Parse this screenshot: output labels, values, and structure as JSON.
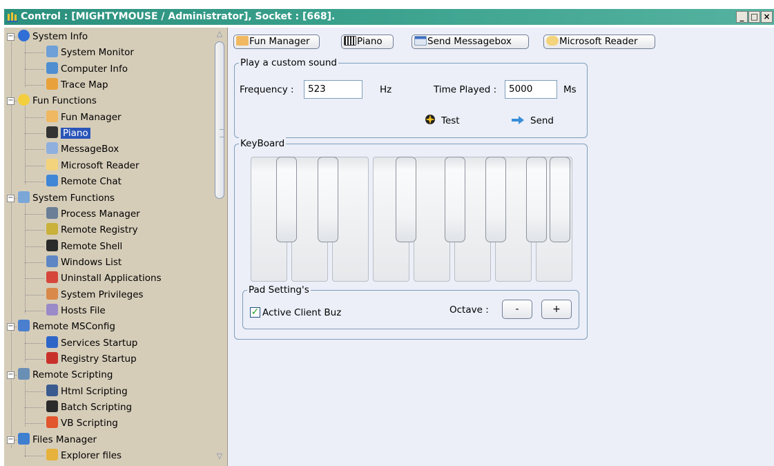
{
  "window": {
    "title": "Control : [MIGHTYMOUSE / Administrator], Socket : [668].",
    "minimize": "_",
    "maximize": "□",
    "close": "×"
  },
  "tree": [
    {
      "label": "System Info",
      "icon": "info-icon",
      "level": 0,
      "expander": "−"
    },
    {
      "label": "System Monitor",
      "icon": "system-monitor-icon",
      "level": 1
    },
    {
      "label": "Computer Info",
      "icon": "computer-icon",
      "level": 1
    },
    {
      "label": "Trace Map",
      "icon": "trace-map-icon",
      "level": 1
    },
    {
      "label": "Fun Functions",
      "icon": "smiley-icon",
      "level": 0,
      "expander": "−"
    },
    {
      "label": "Fun Manager",
      "icon": "fun-manager-icon",
      "level": 1
    },
    {
      "label": "Piano",
      "icon": "piano-icon",
      "level": 1,
      "selected": true
    },
    {
      "label": "MessageBox",
      "icon": "messagebox-icon",
      "level": 1
    },
    {
      "label": "Microsoft Reader",
      "icon": "reader-icon",
      "level": 1
    },
    {
      "label": "Remote Chat",
      "icon": "chat-icon",
      "level": 1
    },
    {
      "label": "System Functions",
      "icon": "system-functions-icon",
      "level": 0,
      "expander": "−"
    },
    {
      "label": "Process Manager",
      "icon": "process-icon",
      "level": 1
    },
    {
      "label": "Remote Registry",
      "icon": "registry-icon",
      "level": 1
    },
    {
      "label": "Remote Shell",
      "icon": "shell-icon",
      "level": 1
    },
    {
      "label": "Windows List",
      "icon": "window-icon",
      "level": 1
    },
    {
      "label": "Uninstall Applications",
      "icon": "uninstall-icon",
      "level": 1
    },
    {
      "label": "System Privileges",
      "icon": "shield-icon",
      "level": 1
    },
    {
      "label": "Hosts File",
      "icon": "hosts-file-icon",
      "level": 1
    },
    {
      "label": "Remote MSConfig",
      "icon": "msconfig-icon",
      "level": 0,
      "expander": "−"
    },
    {
      "label": "Services Startup",
      "icon": "services-icon",
      "level": 1
    },
    {
      "label": "Registry Startup",
      "icon": "toolbox-icon",
      "level": 1
    },
    {
      "label": "Remote Scripting",
      "icon": "script-icon",
      "level": 0,
      "expander": "−"
    },
    {
      "label": "Html Scripting",
      "icon": "html-icon",
      "level": 1
    },
    {
      "label": "Batch Scripting",
      "icon": "batch-icon",
      "level": 1
    },
    {
      "label": "VB Scripting",
      "icon": "vb-icon",
      "level": 1
    },
    {
      "label": "Files Manager",
      "icon": "files-icon",
      "level": 0,
      "expander": "−"
    },
    {
      "label": "Explorer files",
      "icon": "explorer-icon",
      "level": 1
    }
  ],
  "toolbar": {
    "fun_manager": "Fun Manager",
    "piano": "Piano",
    "send_messagebox": "Send Messagebox",
    "microsoft_reader": "Microsoft Reader"
  },
  "sound": {
    "group_title": "Play a custom sound",
    "frequency_label": "Frequency :",
    "frequency_value": "523",
    "frequency_unit": "Hz",
    "time_label": "Time Played :",
    "time_value": "5000",
    "time_unit": "Ms",
    "test_label": "Test",
    "send_label": "Send"
  },
  "keyboard": {
    "group_title": "KeyBoard",
    "white_keys": 8,
    "black_keys": 7
  },
  "pad": {
    "group_title": "Pad Setting's",
    "active_label": "Active Client Buz",
    "active_checked": true,
    "check_mark": "✓",
    "octave_label": "Octave :",
    "minus": "-",
    "plus": "+"
  },
  "colors": {
    "titlebar": "#3aa18d",
    "sidebar": "#d6cdb9",
    "content": "#eceff8",
    "selection": "#2a55b8",
    "groupbox_border": "#7f9db9"
  }
}
